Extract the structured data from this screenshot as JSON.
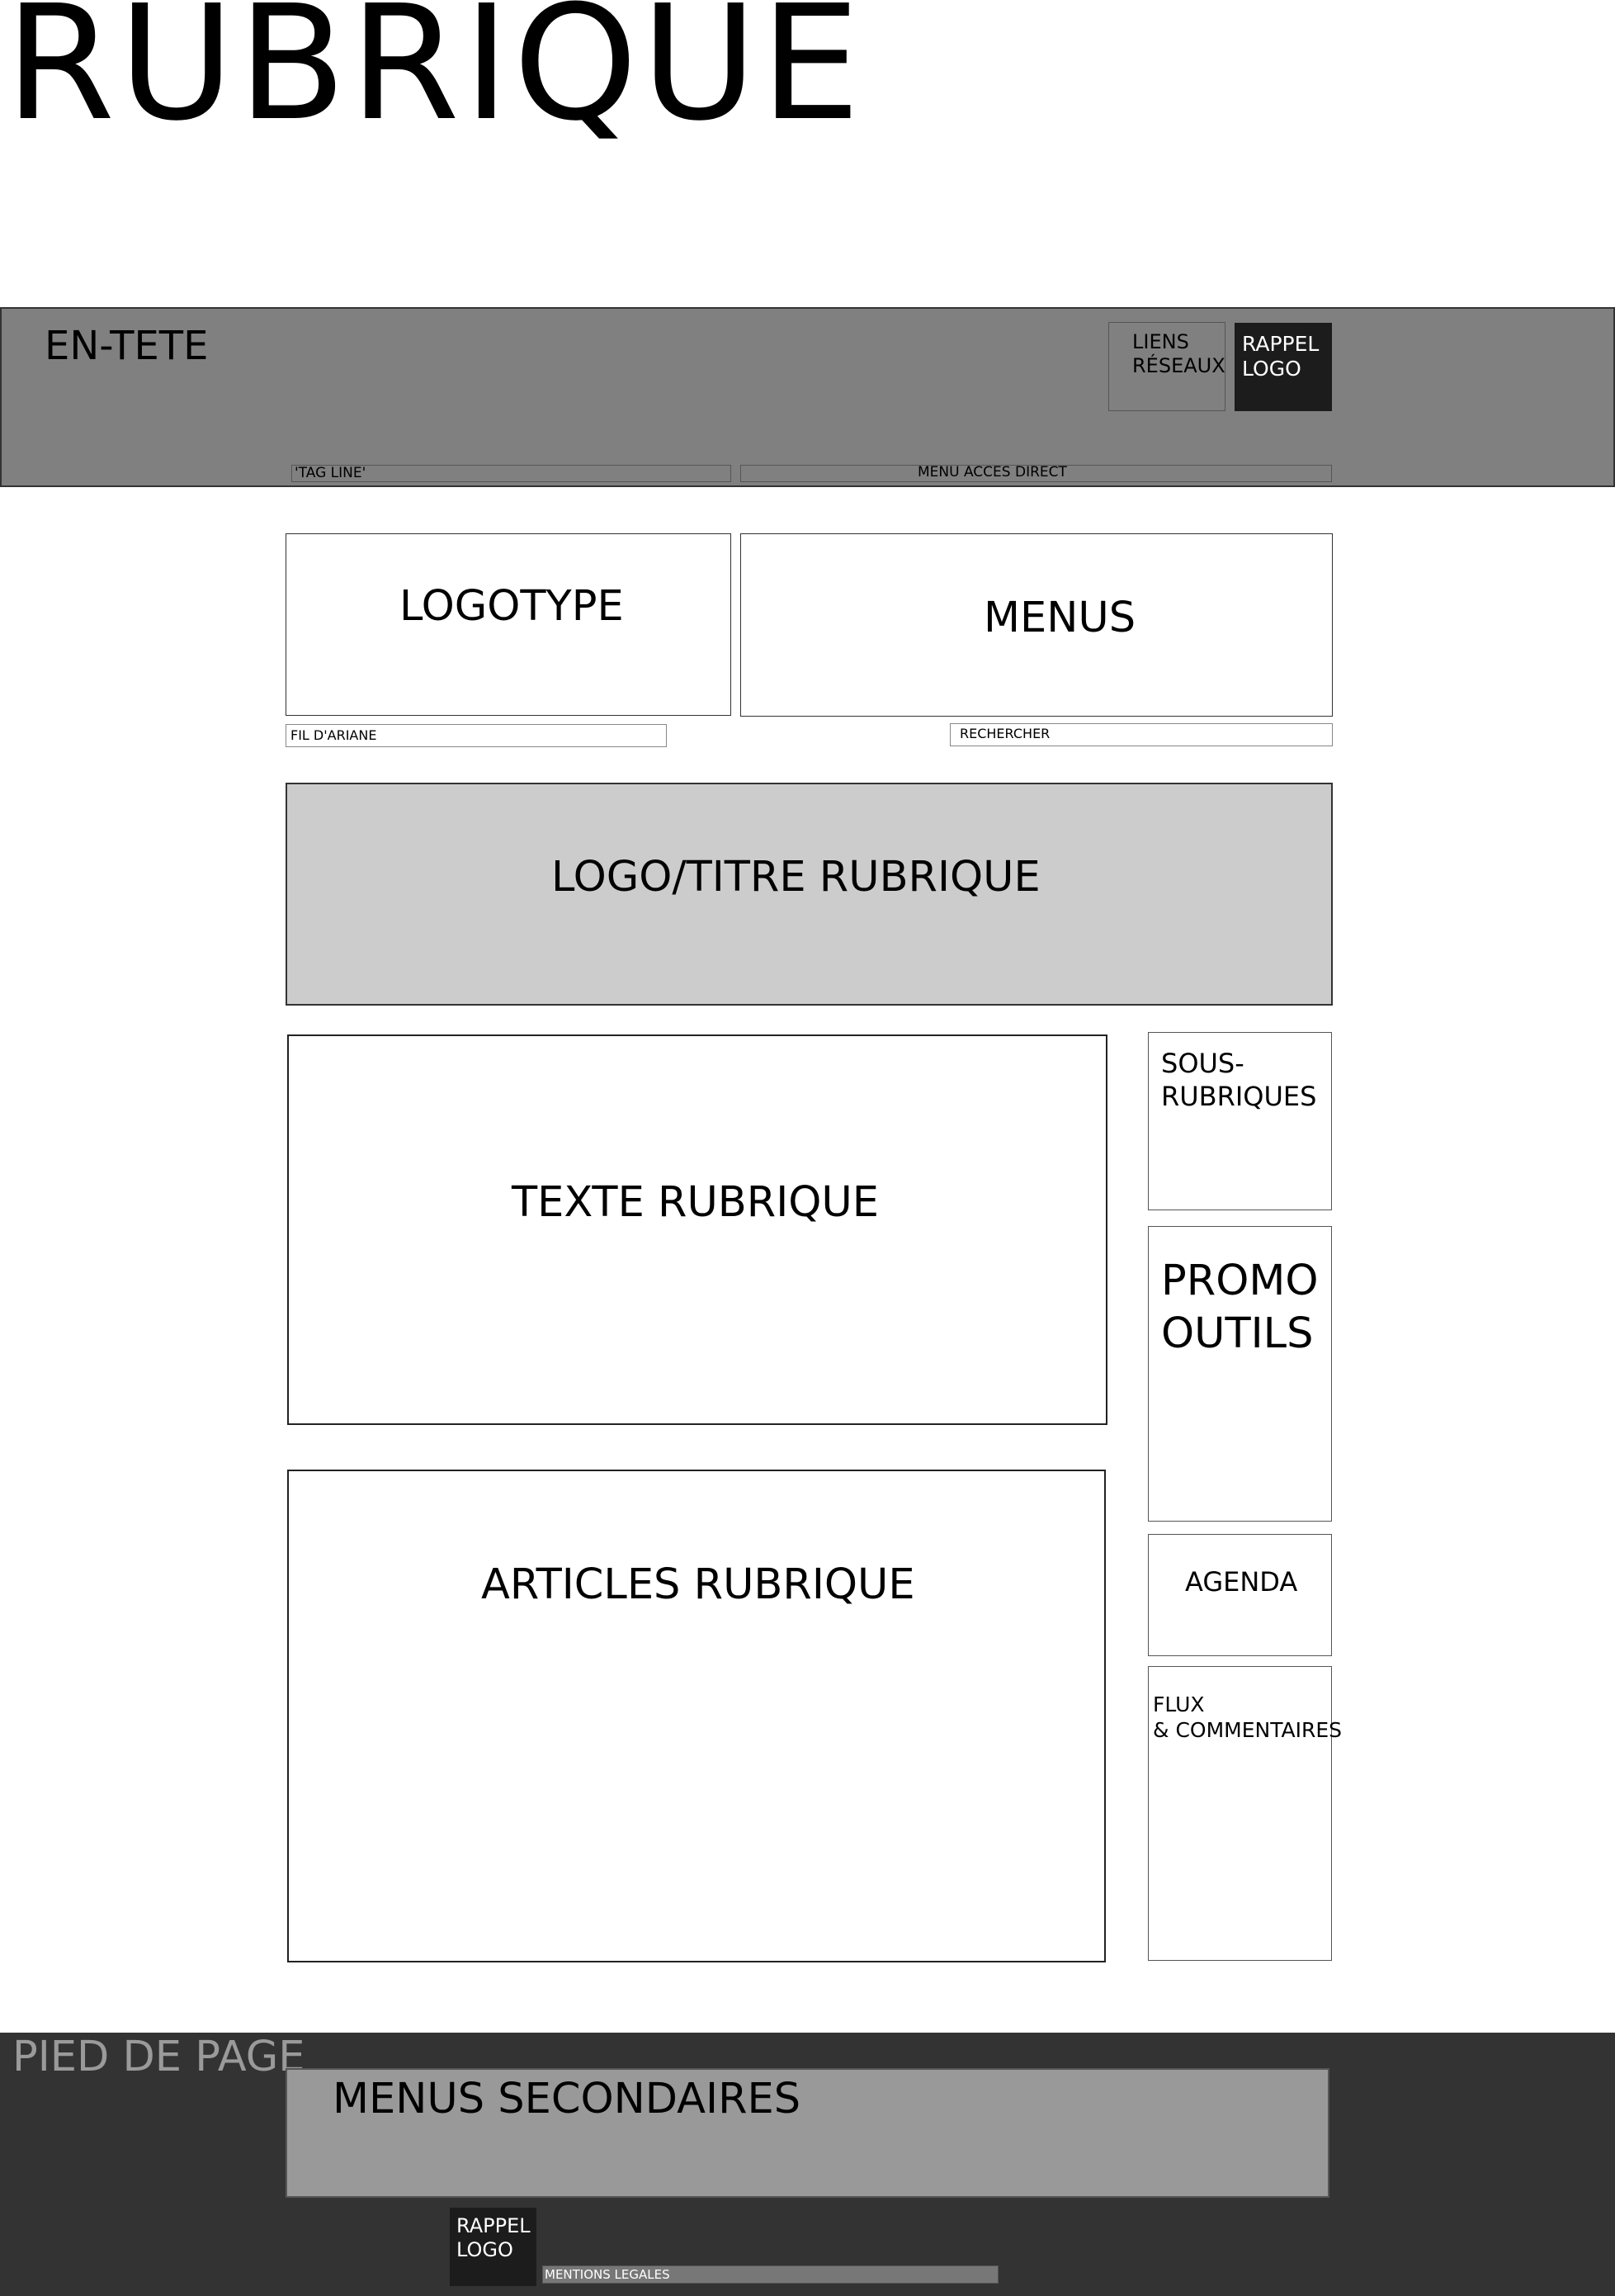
{
  "title": "RUBRIQUE",
  "header": {
    "label": "EN-TETE",
    "social_links": "LIENS\nRÉSEAUX",
    "logo_reminder": "RAPPEL\nLOGO",
    "tagline": "'TAG LINE'",
    "direct_access_menu": "MENU ACCES DIRECT"
  },
  "branding": {
    "logotype": "LOGOTYPE",
    "menus": "MENUS",
    "breadcrumb": "FIL D'ARIANE",
    "search": "RECHERCHER"
  },
  "section_banner": "LOGO/TITRE RUBRIQUE",
  "main": {
    "section_text": "TEXTE RUBRIQUE",
    "section_articles": "ARTICLES RUBRIQUE"
  },
  "sidebar": {
    "subsections": "SOUS-\nRUBRIQUES",
    "promo_tools": "PROMO\nOUTILS",
    "agenda": "AGENDA",
    "feeds_comments": "FLUX\n& COMMENTAIRES"
  },
  "footer": {
    "label": "PIED DE PAGE",
    "secondary_menus": "MENUS SECONDAIRES",
    "logo_reminder": "RAPPEL\nLOGO",
    "legal_notice": "MENTIONS LEGALES"
  },
  "colors": {
    "header_band": "#808080",
    "section_banner": "#cccccc",
    "footer_band": "#333333",
    "secondary_menus": "#999999",
    "logo_block": "#1c1c1c"
  }
}
